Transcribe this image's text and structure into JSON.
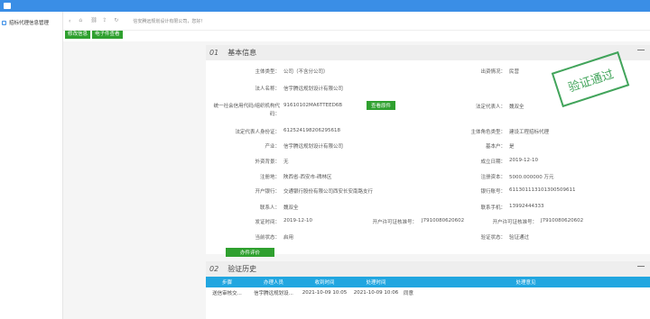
{
  "sidebar": {
    "item_label": "招标代理信息管理"
  },
  "breadcrumb": {
    "path": "信安腾远规划设计有限公司，您好！"
  },
  "toolbar": {
    "btn1": "修改信息",
    "btn2": "电子件查看"
  },
  "basic": {
    "number": "01",
    "title": "基本信息",
    "stamp": "验证通过",
    "fields": {
      "subject_type_label": "主体类型：",
      "subject_type_value": "公司（不含分公司）",
      "legal_name_label": "法人名称：",
      "legal_name_value": "信宇腾远规划设计有限公司",
      "credit_code_label": "统一社会信用代码/组织机构代码：",
      "credit_code_value": "91610102MA6TTEED6B",
      "view_attach": "查看原件",
      "legal_rep_id_label": "法定代表人身份证：",
      "legal_rep_id_value": "612524198206295618",
      "industry_label": "产业：",
      "industry_value": "信宇腾远规划设计有限公司",
      "foreign_label": "外资背景：",
      "foreign_value": "无",
      "reg_addr_label": "注册地：",
      "reg_addr_value": "陕西省-西安市-碑林区",
      "bank_label": "开户银行：",
      "bank_value": "交通银行股份有限公司西安长安南路支行",
      "contact_label": "联系人：",
      "contact_value": "魏双全",
      "issue_time_label": "发证时间：",
      "issue_time_value": "2019-12-10",
      "permit_no_label": "开户许可证核准号：",
      "permit_no_value": "J7910080620602",
      "status_label": "当前状态：",
      "status_value": "启用",
      "eval_btn": "办件评价",
      "source_label": "出资情况：",
      "source_value": "民营",
      "legal_rep_label": "法定代表人：",
      "legal_rep_value": "魏双全",
      "subject_role_label": "主体角色类型：",
      "subject_role_value": "建设工程招标代理",
      "base_house_label": "基本户：",
      "base_house_value": "是",
      "est_date_label": "成立日期：",
      "est_date_value": "2019-12-10",
      "reg_capital_label": "注册资本：",
      "reg_capital_value": "5000.000000 万元",
      "bank_acct_label": "银行账号：",
      "bank_acct_value": "611301113101300509611",
      "phone_label": "联系手机：",
      "phone_value": "13992444333",
      "permit_no2_label": "开户许可证核准号：",
      "permit_no2_value": "J7910080620602",
      "verify_label": "验证状态：",
      "verify_value": "验证通过"
    }
  },
  "history": {
    "number": "02",
    "title": "验证历史",
    "columns": [
      "步骤",
      "办理人员",
      "收到时间",
      "处理时间",
      "处理意见"
    ],
    "rows": [
      [
        "送信审核交...",
        "信宇腾远规划设...",
        "2021-10-09 10:05",
        "2021-10-09 10:06",
        "同意"
      ]
    ]
  }
}
